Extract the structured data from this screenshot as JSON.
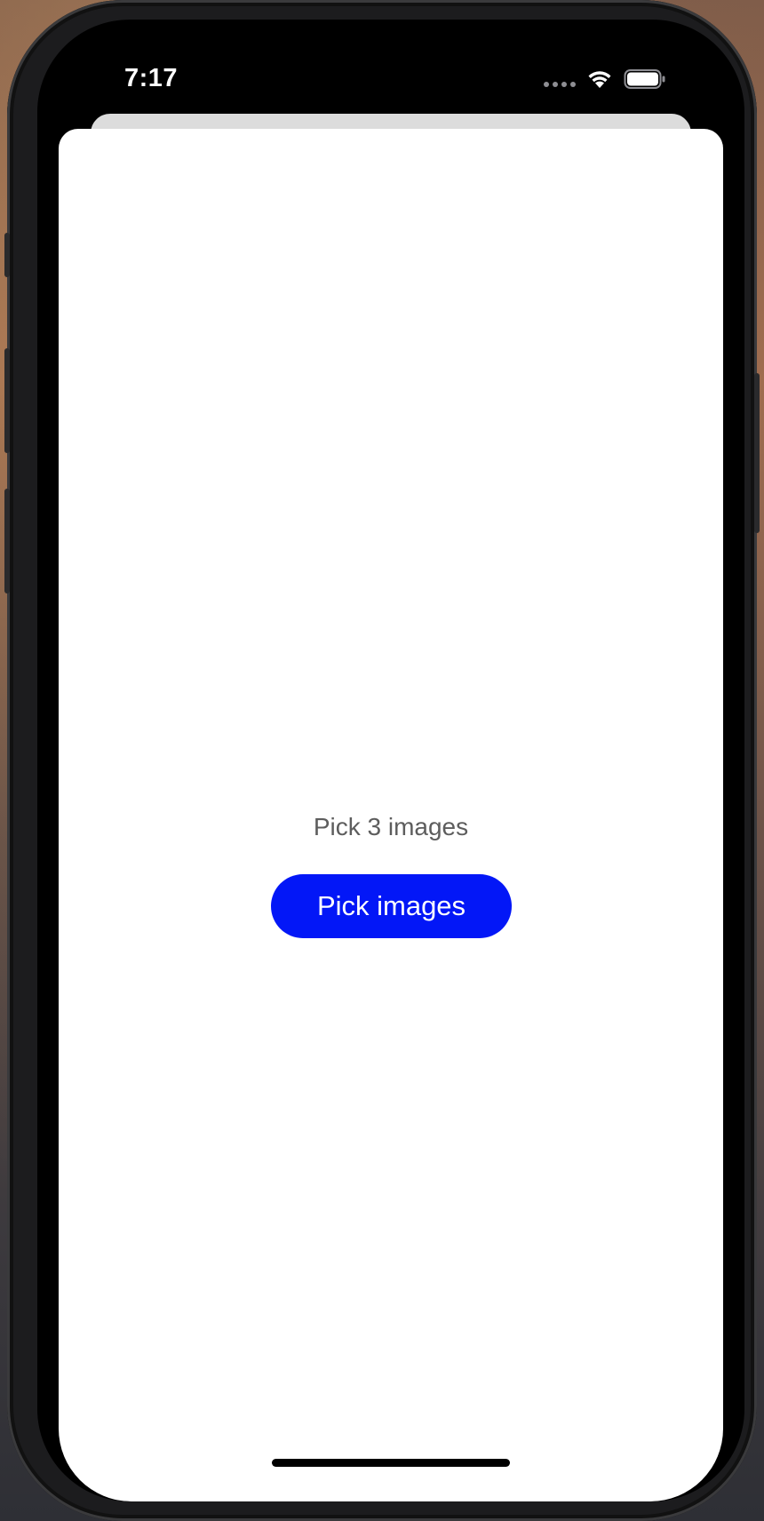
{
  "status_bar": {
    "time": "7:17",
    "icons": [
      "cellular-signal-icon",
      "wifi-icon",
      "battery-icon"
    ]
  },
  "main": {
    "prompt": "Pick 3 images",
    "pick_button_label": "Pick images"
  },
  "colors": {
    "button_background": "#0317f7",
    "button_text": "#ffffff",
    "prompt_text": "#5d5d5d",
    "sheet_background": "#ffffff"
  }
}
